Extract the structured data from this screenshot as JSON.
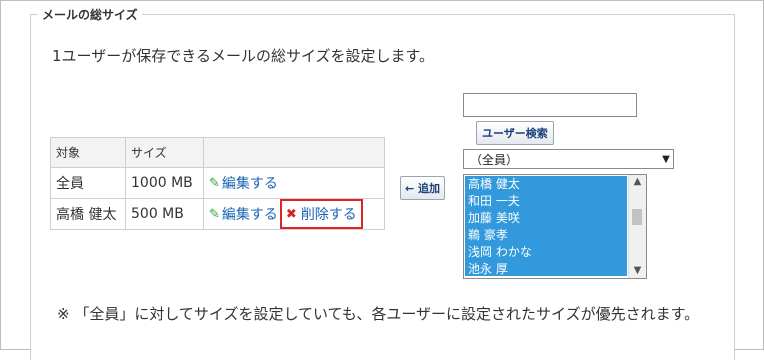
{
  "section": {
    "legend": "メールの総サイズ",
    "description": "1ユーザーが保存できるメールの総サイズを設定します。"
  },
  "table": {
    "headers": [
      "対象",
      "サイズ",
      ""
    ],
    "rows": [
      {
        "target": "全員",
        "size": "1000 MB",
        "edit": "編集する"
      },
      {
        "target": "高橋 健太",
        "size": "500 MB",
        "edit": "編集する",
        "delete": "削除する"
      }
    ]
  },
  "add_button": "← 追加",
  "user_search": {
    "input_value": "",
    "button": "ユーザー検索"
  },
  "group_select": {
    "selected": "（全員）"
  },
  "user_list": [
    "高橋 健太",
    "和田 一夫",
    "加藤 美咲",
    "鵜 豪孝",
    "浅岡 わかな",
    "池永 厚"
  ],
  "note": "※ 「全員」に対してサイズを設定していても、各ユーザーに設定されたサイズが優先されます。",
  "colors": {
    "link": "#1a64b4",
    "selection": "#3399dd",
    "highlight_border": "#e02424",
    "delete_icon": "#d42020",
    "edit_icon": "#3aa040"
  },
  "icons": {
    "edit": "pencil-icon",
    "delete": "cross-icon",
    "select": "chevron-down-icon"
  }
}
